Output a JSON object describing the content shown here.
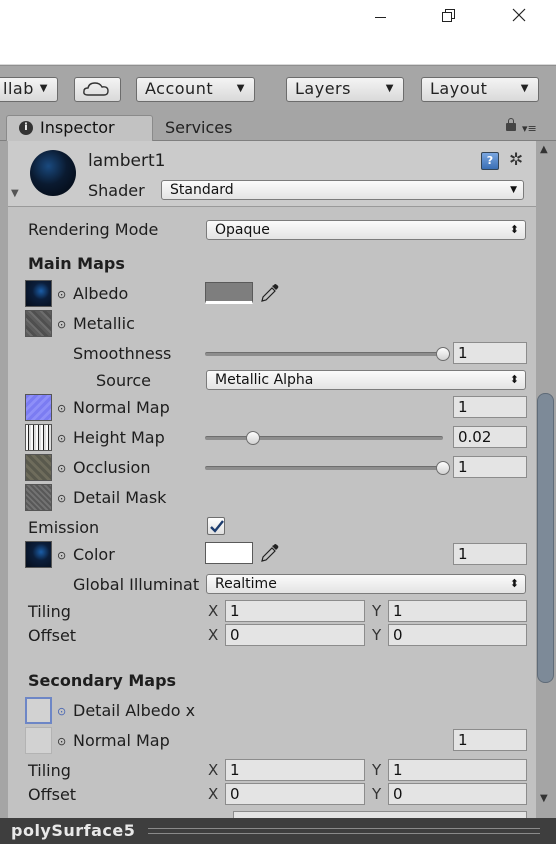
{
  "window": {
    "minimize_icon": "minimize-icon",
    "maximize_icon": "restore-icon",
    "close_icon": "close-icon"
  },
  "toolbar": {
    "collab_label": "llab",
    "cloud_icon": "cloud-icon",
    "account_label": "Account",
    "layers_label": "Layers",
    "layout_label": "Layout"
  },
  "tabs": {
    "inspector": "Inspector",
    "services": "Services"
  },
  "header": {
    "material_name": "lambert1",
    "shader_label": "Shader",
    "shader_value": "Standard"
  },
  "rendering": {
    "label": "Rendering Mode",
    "value": "Opaque"
  },
  "main_maps": {
    "title": "Main Maps",
    "albedo": "Albedo",
    "metallic": "Metallic",
    "smoothness_label": "Smoothness",
    "smoothness_value": "1",
    "smoothness_level": 1.0,
    "source_label": "Source",
    "source_value": "Metallic Alpha",
    "normal_map": "Normal Map",
    "normal_value": "1",
    "height_map": "Height Map",
    "height_value": "0.02",
    "height_level": 0.2,
    "occlusion": "Occlusion",
    "occlusion_value": "1",
    "occlusion_level": 1.0,
    "detail_mask": "Detail Mask",
    "emission_label": "Emission",
    "emission_checked": true,
    "color_label": "Color",
    "color_value": "1",
    "gi_label": "Global Illuminat",
    "gi_value": "Realtime",
    "tiling_label": "Tiling",
    "tiling_x": "1",
    "tiling_y": "1",
    "offset_label": "Offset",
    "offset_x": "0",
    "offset_y": "0",
    "albedo_color": "#7e7e7e",
    "emission_color": "#ffffff"
  },
  "secondary_maps": {
    "title": "Secondary Maps",
    "detail_albedo": "Detail Albedo x",
    "normal_map": "Normal Map",
    "normal_value": "1",
    "tiling_label": "Tiling",
    "tiling_x": "1",
    "tiling_y": "1",
    "offset_label": "Offset",
    "offset_x": "0",
    "offset_y": "0"
  },
  "axes": {
    "x": "X",
    "y": "Y"
  },
  "status": {
    "label": "polySurface5"
  }
}
